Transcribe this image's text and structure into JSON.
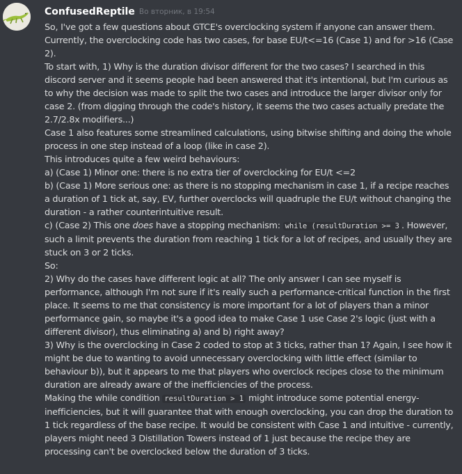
{
  "author": {
    "username": "ConfusedReptile",
    "timestamp": "Во вторник, в 19:54",
    "avatar_icon": "lizard-icon"
  },
  "message": {
    "p01": "So, I've got a few questions about GTCE's overclocking system if anyone can answer them.\n",
    "p02": "Currently, the overclocking code has two cases, for base EU/t<=16 (Case 1) and for >16 (Case 2).\n",
    "p03": "To start with, 1) Why is the duration divisor different for the two cases? I searched in this discord server and it seems people had been answered that it's intentional, but I'm curious as to why the decision was made to split the two cases and introduce the larger divisor only for case 2. (from digging through the code's history, it seems the two cases actually predate the 2.7/2.8x modifiers...)\n",
    "p04": "Case 1 also features some streamlined calculations, using bitwise shifting and doing the whole process in one step instead of a loop (like in case 2).\n",
    "p05": "This introduces quite a few weird behaviours:\n",
    "p06": "a) (Case 1) Minor one: there is no extra tier of overclocking for EU/t <=2\n",
    "p07": "b) (Case 1) More serious one: as there is no stopping mechanism in case 1, if a recipe reaches a duration of 1 tick at, say, EV, further overclocks will quadruple the EU/t without changing the duration - a rather counterintuitive result.\n",
    "p08a": "c) (Case 2) This one ",
    "p08em": "does",
    "p08b": " have a stopping mechanism: ",
    "p08code": "while (resultDuration >= 3",
    "p08c": ". However, such a limit prevents the duration from reaching 1 tick for a lot of recipes, and usually they are stuck on 3 or 2 ticks.\n",
    "p09": "So:\n",
    "p10": "2) Why do the cases have different logic at all? The only answer I can see myself is performance, although I'm not sure if it's really such a performance-critical function in the first place. It seems to me that consistency is more important for a lot of players than a minor performance gain, so maybe it's a good idea to make Case 1 use Case 2's logic (just with a different divisor), thus eliminating a) and b) right away?\n",
    "p11": "3) Why is the overclocking in Case 2 coded to stop at 3 ticks, rather than 1? Again, I see how it might be due to wanting to avoid unnecessary overclocking with little effect (similar to behaviour b)), but it appears to me that players who overclock recipes close to the minimum duration are already aware of the inefficiencies of the process.\n",
    "p12a": "Making the while condition ",
    "p12code": "resultDuration > 1",
    "p12b": " might introduce some potential energy-inefficiencies, but it will guarantee that with enough overclocking, you can drop the duration to 1 tick regardless of the base recipe. It would be consistent with Case 1 and intuitive - currently, players might need 3 Distillation Towers instead of 1 just because the recipe they are processing can't be overclocked below the duration of 3 ticks."
  }
}
